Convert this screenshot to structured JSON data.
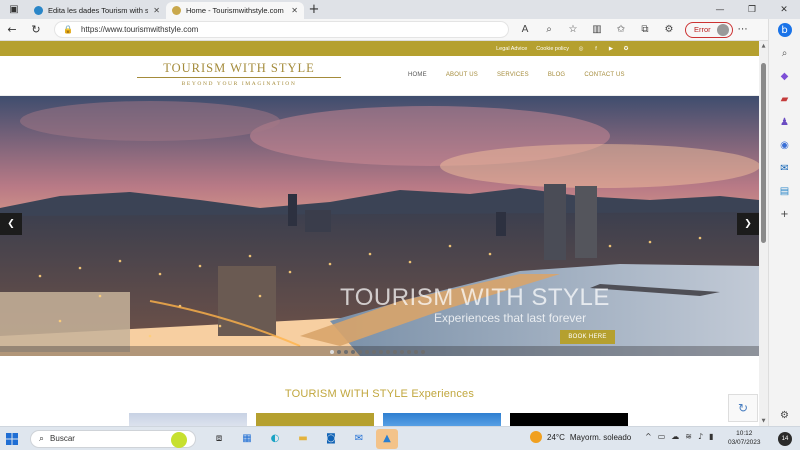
{
  "browser": {
    "tabs": [
      {
        "title": "Edita les dades Tourism with sty...",
        "active": false,
        "favicon_color": "#2a86c8"
      },
      {
        "title": "Home - Tourismwithstyle.com",
        "active": true,
        "favicon_color": "#c9a84c"
      }
    ],
    "url": "https://www.tourismwithstyle.com",
    "error_label": "Error"
  },
  "site": {
    "top_links": [
      "Legal Advice",
      "Cookie policy"
    ],
    "logo_title": "TOURISM WITH STYLE",
    "logo_tagline": "BEYOND YOUR IMAGINATION",
    "nav": [
      {
        "label": "HOME",
        "current": true
      },
      {
        "label": "ABOUT US",
        "current": false
      },
      {
        "label": "SERVICES",
        "current": false
      },
      {
        "label": "BLOG",
        "current": false
      },
      {
        "label": "CONTACT US",
        "current": false
      }
    ],
    "hero": {
      "title": "TOURISM WITH STYLE",
      "subtitle": "Experiences that last forever",
      "button": "BOOK HERE"
    },
    "section_title": "TOURISM WITH STYLE Experiences"
  },
  "taskbar": {
    "search_placeholder": "Buscar",
    "weather_temp": "24°C",
    "weather_text": "Mayorm. soleado",
    "time": "10:12",
    "date": "03/07/2023",
    "notifications": "14"
  },
  "colors": {
    "gold": "#b5a02f",
    "logo_gold": "#a48b3a",
    "error": "#c33333"
  }
}
